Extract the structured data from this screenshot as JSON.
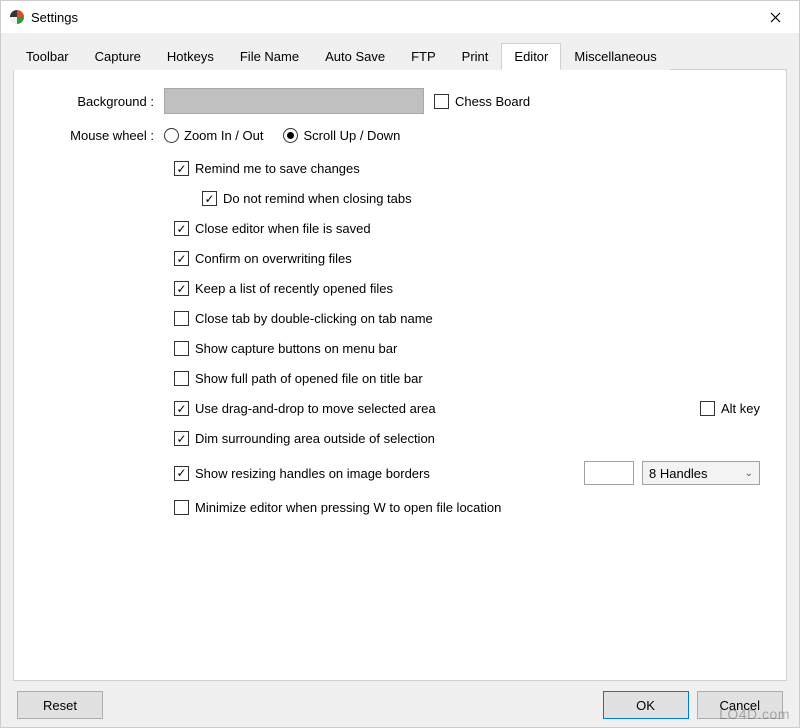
{
  "window": {
    "title": "Settings"
  },
  "tabs": {
    "items": [
      {
        "label": "Toolbar"
      },
      {
        "label": "Capture"
      },
      {
        "label": "Hotkeys"
      },
      {
        "label": "File Name"
      },
      {
        "label": "Auto Save"
      },
      {
        "label": "FTP"
      },
      {
        "label": "Print"
      },
      {
        "label": "Editor"
      },
      {
        "label": "Miscellaneous"
      }
    ],
    "active_index": 7
  },
  "editor": {
    "background_label": "Background :",
    "background_color": "#c0c0c0",
    "chess_board": {
      "label": "Chess Board",
      "checked": false
    },
    "mouse_wheel_label": "Mouse wheel :",
    "mouse_wheel_options": {
      "zoom": "Zoom In / Out",
      "scroll": "Scroll Up / Down",
      "selected": "scroll"
    },
    "opts": {
      "remind_save": {
        "label": "Remind me to save changes",
        "checked": true
      },
      "no_remind_tabs": {
        "label": "Do not remind when closing tabs",
        "checked": true
      },
      "close_on_save": {
        "label": "Close editor when file is saved",
        "checked": true
      },
      "confirm_overwrite": {
        "label": "Confirm on overwriting files",
        "checked": true
      },
      "recent_list": {
        "label": "Keep a list of recently opened files",
        "checked": true
      },
      "close_dblclick": {
        "label": "Close tab by double-clicking on tab name",
        "checked": false
      },
      "capture_buttons": {
        "label": "Show capture buttons on menu bar",
        "checked": false
      },
      "full_path": {
        "label": "Show full path of opened file on title bar",
        "checked": false
      },
      "drag_drop": {
        "label": "Use drag-and-drop to move selected area",
        "checked": true
      },
      "alt_key": {
        "label": "Alt key",
        "checked": false
      },
      "dim_surrounding": {
        "label": "Dim surrounding area outside of selection",
        "checked": true
      },
      "resizing_handles": {
        "label": "Show resizing handles on image borders",
        "checked": true
      },
      "handles_count": "8 Handles",
      "minimize_w": {
        "label": "Minimize editor when pressing W to open file location",
        "checked": false
      }
    }
  },
  "buttons": {
    "reset": "Reset",
    "ok": "OK",
    "cancel": "Cancel"
  },
  "watermark": "LO4D.com"
}
